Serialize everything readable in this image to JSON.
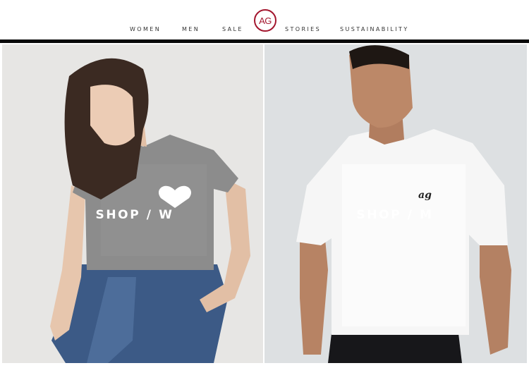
{
  "brand": {
    "logo_text": "AG",
    "accent_color": "#a3162e"
  },
  "nav": {
    "items": [
      {
        "label": "WOMEN"
      },
      {
        "label": "MEN"
      },
      {
        "label": "SALE"
      },
      {
        "label": "STORIES"
      },
      {
        "label": "SUSTAINABILITY"
      }
    ]
  },
  "panels": {
    "women": {
      "cta": "SHOP / W",
      "shirt_graphic": "heart-graphic"
    },
    "men": {
      "cta": "SHOP / M",
      "shirt_graphic": "ag-script-logo"
    }
  }
}
